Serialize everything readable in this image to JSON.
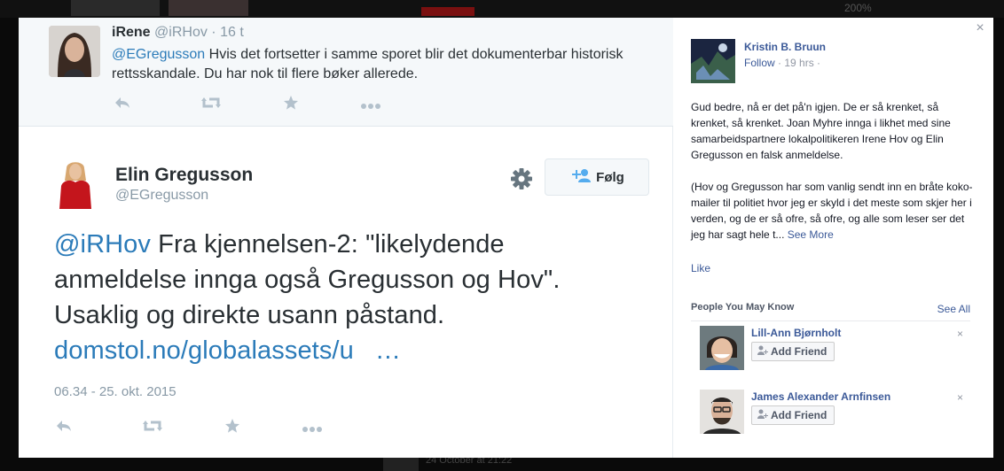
{
  "background": {
    "zoom_text": "200%",
    "bottom_text": "24 October at 21:22"
  },
  "reply_tweet": {
    "name": "iRene",
    "handle": "@iRHov",
    "separator": "·",
    "time": "16 t",
    "mention": "@EGregusson",
    "text": " Hvis det fortsetter i samme sporet blir det dokumenterbar historisk rettsskandale. Du har nok til flere bøker allerede."
  },
  "main_tweet": {
    "name": "Elin Gregusson",
    "handle": "@EGregusson",
    "follow_label": "Følg",
    "mention": "@iRHov",
    "text": " Fra kjennelsen-2: \"likelydende anmeldelse innga også Gregusson og Hov\". Usaklig og direkte usann påstand.",
    "link": "domstol.no/globalassets/u",
    "ellipsis": "…",
    "datetime": "06.34 - 25. okt. 2015"
  },
  "icons": {
    "reply": "reply-icon",
    "retweet": "retweet-icon",
    "favorite": "star-icon",
    "more": "more-icon",
    "gear": "gear-icon",
    "add_person": "add-person-icon",
    "close": "close-icon"
  },
  "facebook": {
    "close_symbol": "×",
    "author": "Kristin B. Bruun",
    "follow_label": "Follow",
    "meta": " · 19 hrs ·",
    "post_p1": "Gud bedre, nå er det på'n igjen. De er så krenket, så krenket, så krenket. Joan Myhre innga i likhet med sine samarbeidspartnere lokalpolitikeren Irene Hov og Elin Gregusson en falsk anmeldelse.",
    "post_p2": "(Hov og Gregusson har som vanlig sendt inn en bråte koko-mailer til politiet hvor jeg er skyld i det meste som skjer her i verden, og de er så ofre, så ofre, og alle som leser ser det jeg har sagt hele t...",
    "see_more": "See More",
    "like_label": "Like",
    "pymk_title": "People You May Know",
    "see_all": "See All",
    "people": [
      {
        "name": "Lill-Ann Bjørnholt",
        "add_label": "Add Friend",
        "dismiss": "×"
      },
      {
        "name": "James Alexander Arnfinsen",
        "add_label": "Add Friend",
        "dismiss": "×"
      }
    ]
  },
  "colors": {
    "twitter_blue": "#2b7bb9",
    "facebook_blue": "#3b5998",
    "muted": "#8899a6"
  }
}
